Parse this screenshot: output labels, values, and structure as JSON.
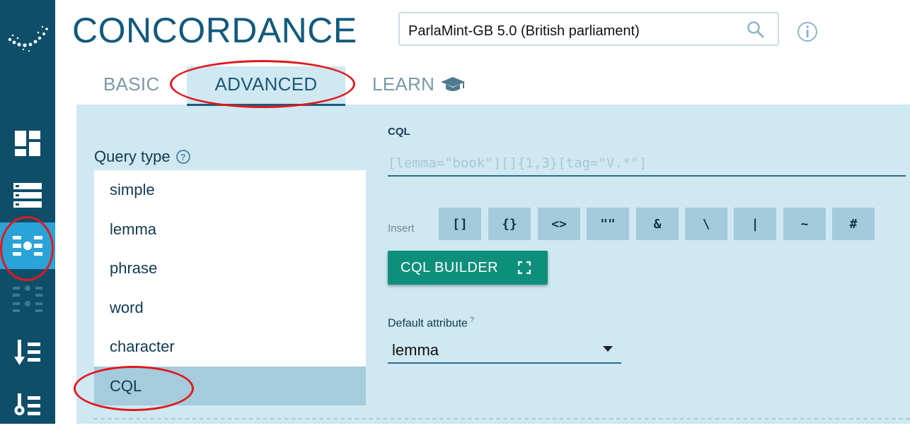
{
  "app": {
    "title": "CONCORDANCE"
  },
  "corpus_selector": {
    "value": "ParlaMint-GB 5.0 (British parliament)"
  },
  "tabs": [
    {
      "label": "BASIC",
      "active": false
    },
    {
      "label": "ADVANCED",
      "active": true
    },
    {
      "label": "LEARN",
      "icon": "graduation-cap-icon",
      "active": false
    }
  ],
  "sidebar": {
    "items": [
      {
        "icon": "dashboard-icon",
        "active": false
      },
      {
        "icon": "list-icon",
        "active": false
      },
      {
        "icon": "concordance-icon",
        "active": true
      },
      {
        "icon": "parallel-concordance-icon",
        "active": false,
        "disabled": true
      },
      {
        "icon": "sort-down-icon",
        "active": false
      },
      {
        "icon": "sort-list-icon",
        "active": false
      }
    ]
  },
  "query_type": {
    "label": "Query type",
    "help": "?",
    "options": [
      "simple",
      "lemma",
      "phrase",
      "word",
      "character",
      "CQL"
    ],
    "selected": "CQL"
  },
  "cql": {
    "label": "CQL",
    "placeholder": "[lemma=\"book\"][]{1,3}[tag=\"V.*\"]",
    "value": ""
  },
  "insert": {
    "label": "Insert",
    "buttons": [
      "[]",
      "{}",
      "<>",
      "\"\"",
      "&",
      "\\",
      "|",
      "~",
      "#"
    ]
  },
  "cql_builder": {
    "label": "CQL BUILDER"
  },
  "default_attribute": {
    "label": "Default attribute",
    "help": "?",
    "value": "lemma"
  },
  "colors": {
    "sidebar": "#0e4e69",
    "sidebar_active": "#2aa3d9",
    "panel": "#cfe8f2",
    "accent_button": "#0e8f7c",
    "title": "#125a7c",
    "annotation": "#e0191e"
  }
}
